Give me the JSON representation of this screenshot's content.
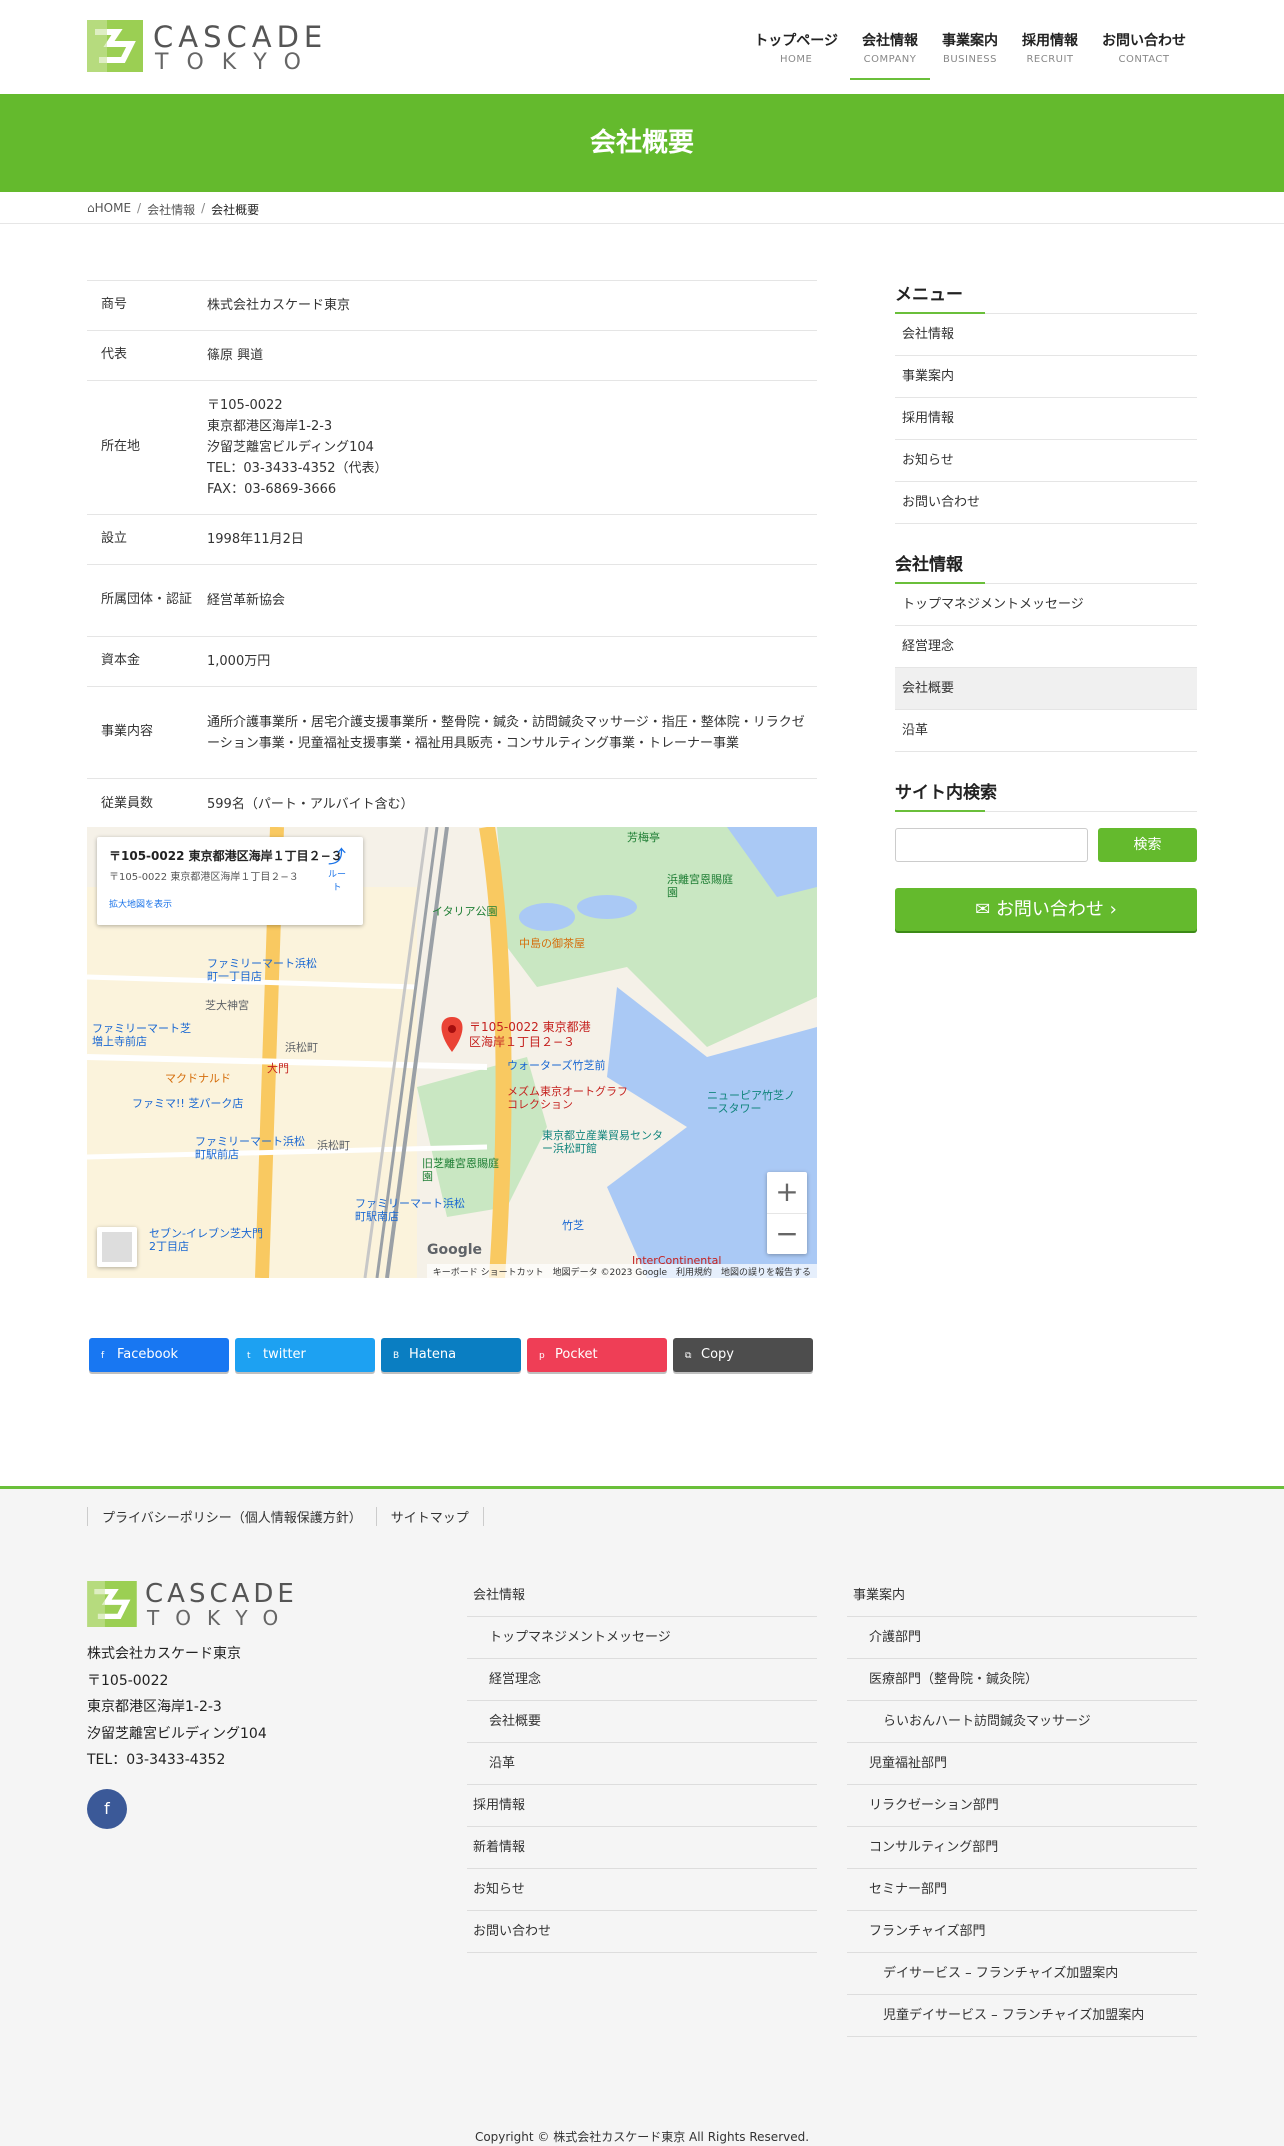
{
  "brand": {
    "name_line1": "CASCADE",
    "name_line2": "TOKYO",
    "accent": "#64ba2d"
  },
  "nav": [
    {
      "jp": "トップページ",
      "en": "HOME"
    },
    {
      "jp": "会社情報",
      "en": "COMPANY",
      "active": true
    },
    {
      "jp": "事業案内",
      "en": "BUSINESS"
    },
    {
      "jp": "採用情報",
      "en": "RECRUIT"
    },
    {
      "jp": "お問い合わせ",
      "en": "CONTACT"
    }
  ],
  "page_title": "会社概要",
  "breadcrumb": {
    "home": "HOME",
    "parent": "会社情報",
    "current": "会社概要",
    "sep": "/"
  },
  "company": [
    {
      "label": "商号",
      "value": "株式会社カスケード東京"
    },
    {
      "label": "代表",
      "value": "篠原 興道"
    },
    {
      "label": "所在地",
      "value": "〒105-0022\n東京都港区海岸1-2-3\n汐留芝離宮ビルディング104\nTEL：03-3433-4352（代表）\nFAX：03-6869-3666"
    },
    {
      "label": "設立",
      "value": "1998年11月2日"
    },
    {
      "label": "所属団体・認証",
      "value": "経営革新協会"
    },
    {
      "label": "資本金",
      "value": "1,000万円"
    },
    {
      "label": "事業内容",
      "value": "通所介護事業所・居宅介護支援事業所・整骨院・鍼灸・訪問鍼灸マッサージ・指圧・整体院・リラクゼーション事業・児童福祉支援事業・福祉用具販売・コンサルティング事業・トレーナー事業"
    },
    {
      "label": "従業員数",
      "value": "599名（パート・アルバイト含む）"
    }
  ],
  "map": {
    "card_title": "〒105-0022 東京都港区海岸１丁目２−３",
    "card_subtitle": "〒105-0022 東京都港区海岸１丁目２−３",
    "card_link": "拡大地図を表示",
    "directions": "ルート",
    "pin_label_1": "〒105-0022 東京都港",
    "pin_label_2": "区海岸１丁目２−３",
    "places": [
      {
        "label": "芳梅亭"
      },
      {
        "label": "浜離宮恩賜庭園"
      },
      {
        "label": "中島の御茶屋"
      },
      {
        "label": "イタリア公園"
      },
      {
        "label": "ウォーターズ竹芝前"
      },
      {
        "label": "メズム東京オートグラフコレクション"
      },
      {
        "label": "東京都立産業貿易センター浜松町館"
      },
      {
        "label": "旧芝離宮恩賜庭園"
      },
      {
        "label": "ファミリーマート浜松町一丁目店"
      },
      {
        "label": "芝大神宮"
      },
      {
        "label": "ファミリーマート芝増上寺前店"
      },
      {
        "label": "浜松町"
      },
      {
        "label": "大門"
      },
      {
        "label": "マクドナルド"
      },
      {
        "label": "ファミマ!! 芝パーク店"
      },
      {
        "label": "ファミリーマート浜松町駅前店"
      },
      {
        "label": "浜松町"
      },
      {
        "label": "ファミリーマート浜松町駅南店"
      },
      {
        "label": "セブン-イレブン芝大門2丁目店"
      },
      {
        "label": "竹芝"
      },
      {
        "label": "InterContinental"
      },
      {
        "label": "ニューピア竹芝ノースタワー"
      }
    ],
    "google": "Google",
    "attribution": "キーボード ショートカット　地図データ ©2023 Google　利用規約　地図の誤りを報告する",
    "zoom_in": "+",
    "zoom_out": "−"
  },
  "share": [
    {
      "label": "Facebook",
      "color": "#1877f2"
    },
    {
      "label": "twitter",
      "color": "#1da1f2"
    },
    {
      "label": "Hatena",
      "color": "#0a7ec2"
    },
    {
      "label": "Pocket",
      "color": "#ef3e56"
    },
    {
      "label": "Copy",
      "color": "#4d4d4d"
    }
  ],
  "sidebar": {
    "menu_title": "メニュー",
    "menu": [
      "会社情報",
      "事業案内",
      "採用情報",
      "お知らせ",
      "お問い合わせ"
    ],
    "company_title": "会社情報",
    "company_items": [
      {
        "label": "トップマネジメントメッセージ"
      },
      {
        "label": "経営理念"
      },
      {
        "label": "会社概要",
        "current": true
      },
      {
        "label": "沿革"
      }
    ],
    "search_title": "サイト内検索",
    "search_button": "検索",
    "contact_button": "お問い合わせ"
  },
  "footer": {
    "links": [
      "プライバシーポリシー（個人情報保護方針）",
      "サイトマップ"
    ],
    "address": [
      "株式会社カスケード東京",
      "〒105-0022",
      "東京都港区海岸1-2-3",
      "汐留芝離宮ビルディング104",
      "TEL：03-3433-4352"
    ],
    "col1": [
      {
        "label": "会社情報",
        "level": 1
      },
      {
        "label": "トップマネジメントメッセージ",
        "level": 2
      },
      {
        "label": "経営理念",
        "level": 2
      },
      {
        "label": "会社概要",
        "level": 2
      },
      {
        "label": "沿革",
        "level": 2
      },
      {
        "label": "採用情報",
        "level": 1
      },
      {
        "label": "新着情報",
        "level": 1
      },
      {
        "label": "お知らせ",
        "level": 1
      },
      {
        "label": "お問い合わせ",
        "level": 1
      }
    ],
    "col2": [
      {
        "label": "事業案内",
        "level": 1
      },
      {
        "label": "介護部門",
        "level": 2
      },
      {
        "label": "医療部門（整骨院・鍼灸院）",
        "level": 2
      },
      {
        "label": "らいおんハート訪問鍼灸マッサージ",
        "level": 3
      },
      {
        "label": "児童福祉部門",
        "level": 2
      },
      {
        "label": "リラクゼーション部門",
        "level": 2
      },
      {
        "label": "コンサルティング部門",
        "level": 2
      },
      {
        "label": "セミナー部門",
        "level": 2
      },
      {
        "label": "フランチャイズ部門",
        "level": 2
      },
      {
        "label": "デイサービス – フランチャイズ加盟案内",
        "level": 3
      },
      {
        "label": "児童デイサービス – フランチャイズ加盟案内",
        "level": 3
      }
    ],
    "copyright": "Copyright © 株式会社カスケード東京 All Rights Reserved."
  }
}
